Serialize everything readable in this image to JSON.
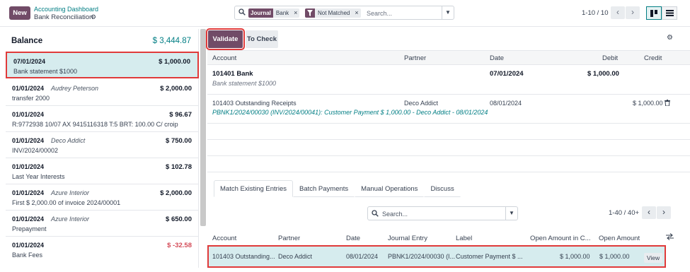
{
  "control_panel": {
    "new_label": "New",
    "breadcrumb_parent": "Accounting Dashboard",
    "breadcrumb_current": "Bank Reconciliation",
    "search": {
      "facets": [
        {
          "label": "Journal",
          "value": "Bank"
        },
        {
          "label": "filter-icon",
          "value": "Not Matched"
        }
      ],
      "placeholder": "Search..."
    },
    "pager": "1-10 / 10"
  },
  "left_panel": {
    "balance_title": "Balance",
    "balance_amount": "$ 3,444.87",
    "lines": [
      {
        "date": "07/01/2024",
        "partner": "",
        "amount": "$ 1,000.00",
        "label": "Bank statement $1000",
        "selected": true
      },
      {
        "date": "01/01/2024",
        "partner": "Audrey Peterson",
        "amount": "$ 2,000.00",
        "label": "transfer 2000"
      },
      {
        "date": "01/01/2024",
        "partner": "",
        "amount": "$ 96.67",
        "label": "R:9772938 10/07 AX 9415116318 T:5 BRT: 100.00 C/ croip"
      },
      {
        "date": "01/01/2024",
        "partner": "Deco Addict",
        "amount": "$ 750.00",
        "label": "INV/2024/00002"
      },
      {
        "date": "01/01/2024",
        "partner": "",
        "amount": "$ 102.78",
        "label": "Last Year Interests"
      },
      {
        "date": "01/01/2024",
        "partner": "Azure Interior",
        "amount": "$ 2,000.00",
        "label": "First $ 2,000.00 of invoice 2024/00001"
      },
      {
        "date": "01/01/2024",
        "partner": "Azure Interior",
        "amount": "$ 650.00",
        "label": "Prepayment"
      },
      {
        "date": "01/01/2024",
        "partner": "",
        "amount": "$ -32.58",
        "label": "Bank Fees",
        "negative": true
      }
    ]
  },
  "right_panel": {
    "validate_label": "Validate",
    "to_check_label": "To Check",
    "columns": {
      "account": "Account",
      "partner": "Partner",
      "date": "Date",
      "debit": "Debit",
      "credit": "Credit"
    },
    "statement_line": {
      "account": "101401 Bank",
      "label": "Bank statement $1000",
      "date": "07/01/2024",
      "debit": "$ 1,000.00"
    },
    "matched_line": {
      "account": "101403 Outstanding Receipts",
      "partner": "Deco Addict",
      "date": "08/01/2024",
      "credit": "$ 1,000.00",
      "description": "PBNK1/2024/00030 (INV/2024/00041): Customer Payment $ 1,000.00 - Deco Addict - 08/01/2024"
    },
    "tabs": [
      "Match Existing Entries",
      "Batch Payments",
      "Manual Operations",
      "Discuss"
    ],
    "search_placeholder": "Search...",
    "pager": "1-40 / 40+",
    "entries_columns": {
      "account": "Account",
      "partner": "Partner",
      "date": "Date",
      "journal_entry": "Journal Entry",
      "label": "Label",
      "open_amount_currency": "Open Amount in C...",
      "open_amount": "Open Amount"
    },
    "entries": [
      {
        "account": "101403 Outstanding...",
        "partner": "Deco Addict",
        "date": "08/01/2024",
        "journal_entry": "PBNK1/2024/00030 (I...",
        "label": "Customer Payment $ ...",
        "open_amount_currency": "$ 1,000.00",
        "open_amount": "$ 1,000.00",
        "button": "View"
      }
    ]
  }
}
